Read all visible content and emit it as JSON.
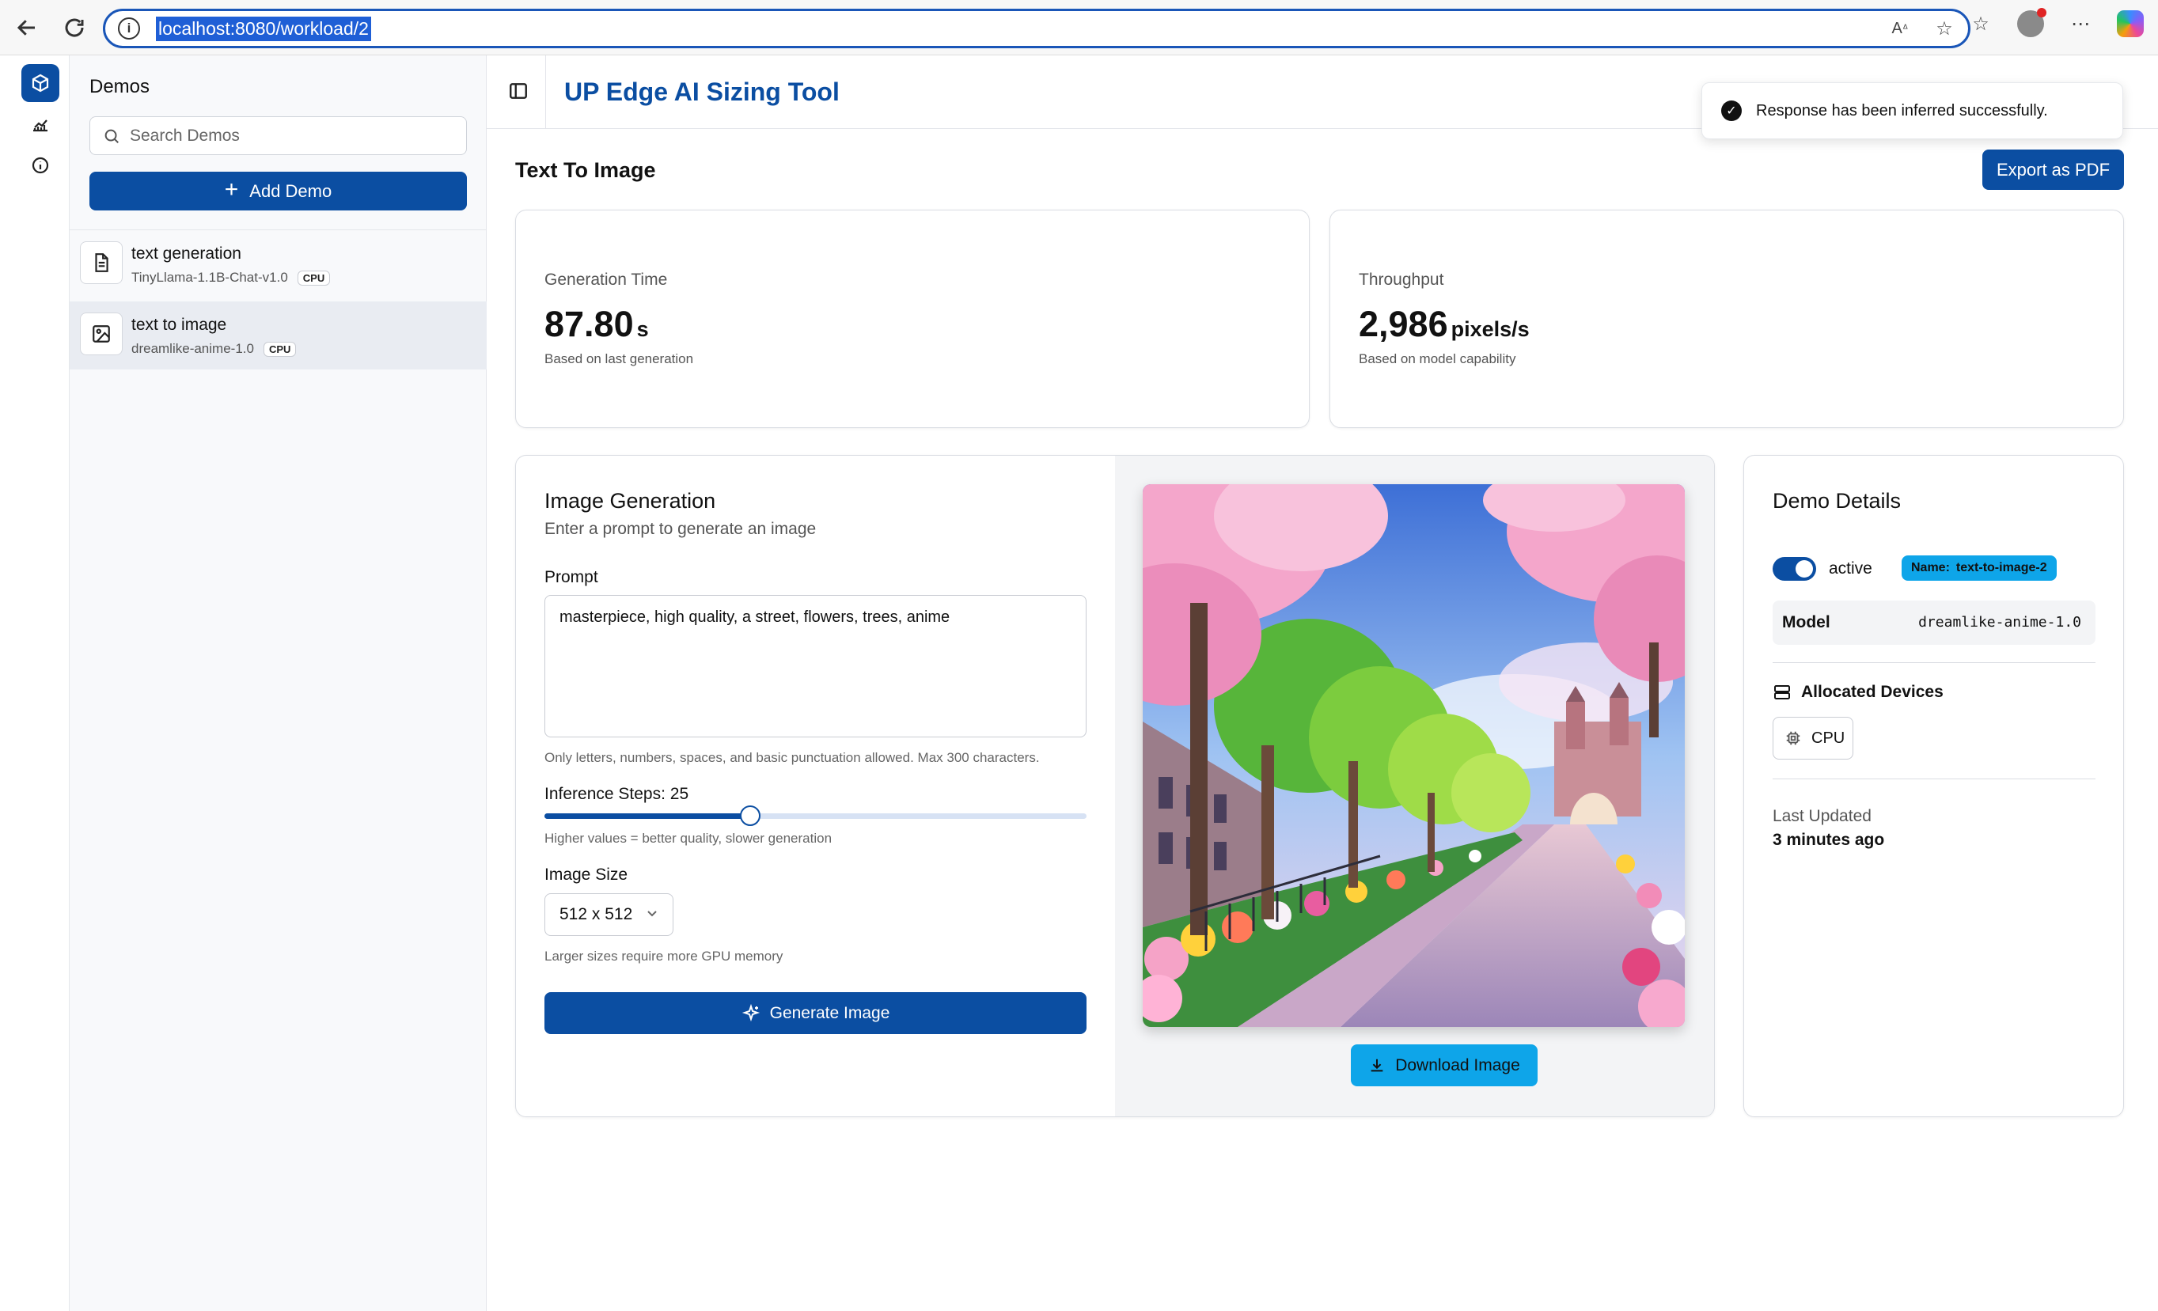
{
  "browser": {
    "url": "localhost:8080/workload/2"
  },
  "sidebar": {
    "title": "Demos",
    "search_placeholder": "Search Demos",
    "add_label": "Add Demo",
    "items": [
      {
        "name": "text generation",
        "model": "TinyLlama-1.1B-Chat-v1.0",
        "device": "CPU",
        "icon": "file-text-icon"
      },
      {
        "name": "text to image",
        "model": "dreamlike-anime-1.0",
        "device": "CPU",
        "icon": "image-icon"
      }
    ]
  },
  "header": {
    "title": "UP Edge AI Sizing Tool"
  },
  "toast": {
    "message": "Response has been inferred successfully."
  },
  "page": {
    "title": "Text To Image",
    "export_label": "Export as PDF"
  },
  "metrics": {
    "generation_time": {
      "label": "Generation Time",
      "value": "87.80",
      "unit": "s",
      "note": "Based on last generation"
    },
    "throughput": {
      "label": "Throughput",
      "value": "2,986",
      "unit": "pixels/s",
      "note": "Based on model capability"
    }
  },
  "generation": {
    "title": "Image Generation",
    "subtitle": "Enter a prompt to generate an image",
    "prompt_label": "Prompt",
    "prompt_value": "masterpiece, high quality, a street, flowers, trees, anime",
    "prompt_hint": "Only letters, numbers, spaces, and basic punctuation allowed. Max 300 characters.",
    "steps_label": "Inference Steps: 25",
    "steps_value": 25,
    "steps_fraction": 0.38,
    "steps_hint": "Higher values = better quality, slower generation",
    "size_label": "Image Size",
    "size_value": "512 x 512",
    "size_hint": "Larger sizes require more GPU memory",
    "generate_label": "Generate Image",
    "download_label": "Download Image"
  },
  "details": {
    "title": "Demo Details",
    "status": "active",
    "name_key": "Name:",
    "name_value": "text-to-image-2",
    "model_label": "Model",
    "model_value": "dreamlike-anime-1.0",
    "devices_label": "Allocated Devices",
    "device": "CPU",
    "updated_label": "Last Updated",
    "updated_value": "3 minutes ago"
  },
  "colors": {
    "primary": "#0b4ea2",
    "accent": "#0ea5e9"
  }
}
